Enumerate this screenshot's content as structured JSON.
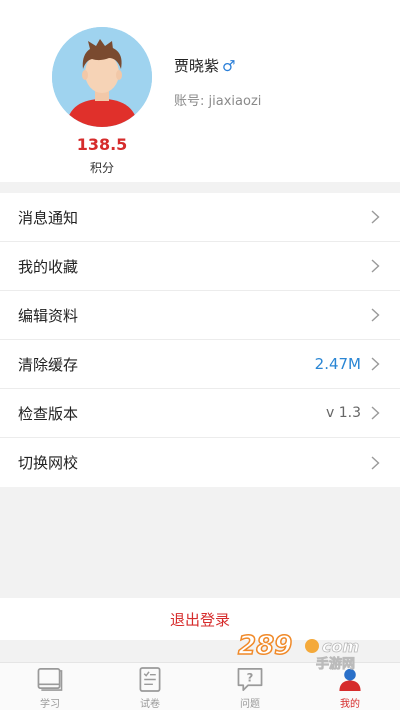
{
  "profile": {
    "name": "贾晓紫",
    "gender_symbol": "♂",
    "account_label": "账号:",
    "account_value": "jiaxiaozi",
    "points_value": "138.5",
    "points_label": "积分"
  },
  "menu": {
    "items": [
      {
        "label": "消息通知",
        "value": ""
      },
      {
        "label": "我的收藏",
        "value": ""
      },
      {
        "label": "编辑资料",
        "value": ""
      },
      {
        "label": "清除缓存",
        "value": "2.47M"
      },
      {
        "label": "检查版本",
        "value": "v 1.3"
      },
      {
        "label": "切换网校",
        "value": ""
      }
    ]
  },
  "logout_label": "退出登录",
  "tabs": [
    {
      "label": "学习",
      "icon": "book-icon"
    },
    {
      "label": "试卷",
      "icon": "paper-icon"
    },
    {
      "label": "问题",
      "icon": "question-icon"
    },
    {
      "label": "我的",
      "icon": "user-icon",
      "active": true
    }
  ],
  "watermark": {
    "text": "289.com",
    "subtext": "手游网"
  },
  "colors": {
    "accent_red": "#d62c2c",
    "accent_blue": "#2a86d4",
    "avatar_bg": "#9fd3ef"
  }
}
